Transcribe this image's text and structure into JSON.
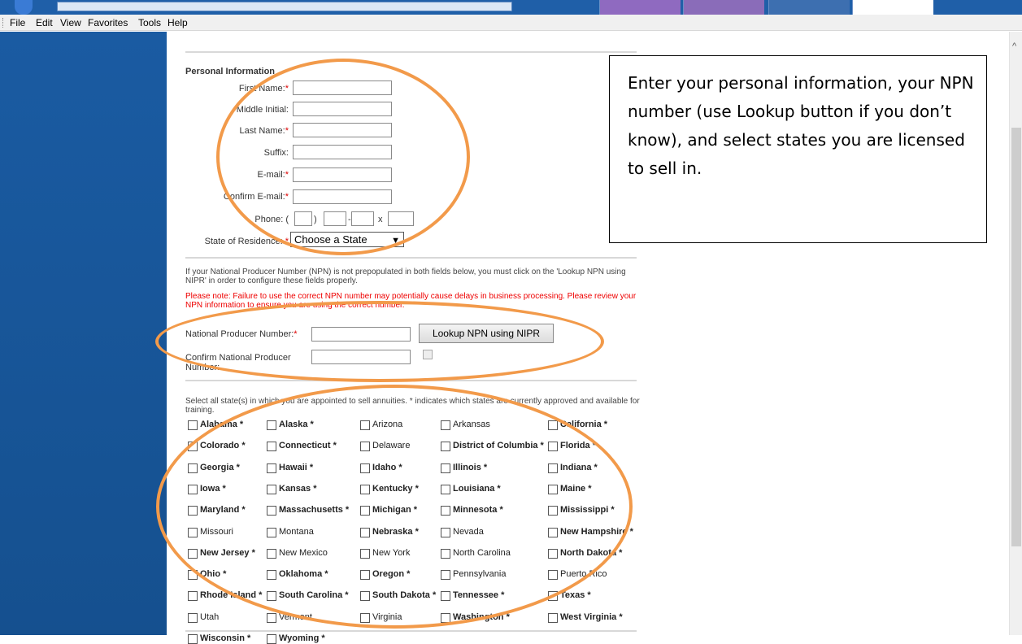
{
  "menu": [
    "File",
    "Edit",
    "View",
    "Favorites",
    "Tools",
    "Help"
  ],
  "personal": {
    "heading": "Personal Information",
    "first_name": "First Name:",
    "middle_initial": "Middle Initial:",
    "last_name": "Last Name:",
    "suffix": "Suffix:",
    "email": "E-mail:",
    "confirm_email": "Confirm E-mail:",
    "phone": "Phone:",
    "phone_open": "(",
    "phone_close": ")",
    "phone_dash": "-",
    "phone_x": "x",
    "state_of_residence": "State of Residence:",
    "state_select": "Choose a State",
    "required": "*"
  },
  "npn": {
    "note": "If your National Producer Number (NPN) is not prepopulated in both fields below, you must click on the 'Lookup NPN using NIPR' in order to configure these fields properly.",
    "warning": "Please note: Failure to use the correct NPN number may potentially cause delays in business processing. Please review your NPN information to ensure you are using the correct number.",
    "npn_label": "National Producer Number:",
    "confirm_label": "Confirm National Producer Number:",
    "lookup_button": "Lookup NPN using NIPR"
  },
  "states_section": {
    "instruction": "Select all state(s) in which you are appointed to sell annuities. * indicates which states are currently approved and available for training.",
    "rows": [
      [
        "Alabama *",
        "Alaska *",
        "Arizona",
        "Arkansas",
        "California *"
      ],
      [
        "Colorado *",
        "Connecticut *",
        "Delaware",
        "District of Columbia *",
        "Florida *"
      ],
      [
        "Georgia *",
        "Hawaii *",
        "Idaho *",
        "Illinois *",
        "Indiana *"
      ],
      [
        "Iowa *",
        "Kansas *",
        "Kentucky *",
        "Louisiana *",
        "Maine *"
      ],
      [
        "Maryland *",
        "Massachusetts *",
        "Michigan *",
        "Minnesota *",
        "Mississippi *"
      ],
      [
        "Missouri",
        "Montana",
        "Nebraska *",
        "Nevada",
        "New Hampshire *"
      ],
      [
        "New Jersey *",
        "New Mexico",
        "New York",
        "North Carolina",
        "North Dakota *"
      ],
      [
        "Ohio *",
        "Oklahoma *",
        "Oregon *",
        "Pennsylvania",
        "Puerto Rico"
      ],
      [
        "Rhode Island *",
        "South Carolina *",
        "South Dakota *",
        "Tennessee *",
        "Texas *"
      ],
      [
        "Utah",
        "Vermont",
        "Virginia",
        "Washington *",
        "West Virginia *"
      ],
      [
        "Wisconsin *",
        "Wyoming *"
      ]
    ]
  },
  "callout": {
    "text": "Enter your personal information, your NPN number (use Lookup button if you don’t know), and select states you are licensed to sell in."
  },
  "colors": {
    "annotation": "#f29a4a",
    "required": "#dd0000",
    "sidebar": "#1a5ba2"
  }
}
